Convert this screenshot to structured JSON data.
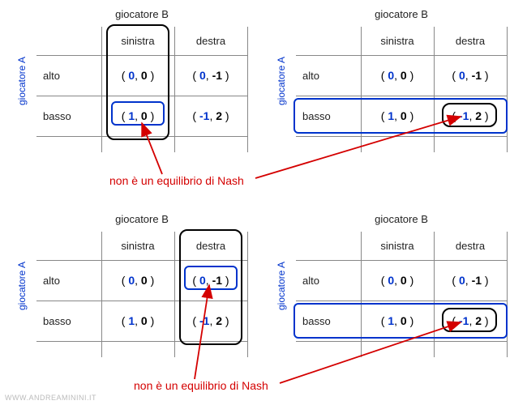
{
  "labels": {
    "playerA": "giocatore A",
    "playerB": "giocatore B",
    "left": "sinistra",
    "right": "destra",
    "top": "alto",
    "bottom": "basso",
    "caption": "non è un equilibrio di Nash",
    "watermark": "WWW.ANDREAMININI.IT"
  },
  "payoffs": {
    "alto_sinistra": {
      "a": "0",
      "b": "0"
    },
    "alto_destra": {
      "a": "0",
      "b": "-1"
    },
    "basso_sinistra": {
      "a": "1",
      "b": "0"
    },
    "basso_destra": {
      "a": "-1",
      "b": "2"
    }
  },
  "chart_data": {
    "type": "table",
    "description": "Four identical 2x2 payoff matrices (game theory normal form). Rows = giocatore A strategies (alto, basso). Columns = giocatore B strategies (sinistra, destra). Cell = (payoff A, payoff B).",
    "row_player": "giocatore A",
    "col_player": "giocatore B",
    "rows": [
      "alto",
      "basso"
    ],
    "cols": [
      "sinistra",
      "destra"
    ],
    "matrix": [
      [
        [
          0,
          0
        ],
        [
          0,
          -1
        ]
      ],
      [
        [
          1,
          0
        ],
        [
          -1,
          2
        ]
      ]
    ],
    "highlights": [
      {
        "panel": 0,
        "black_box": "column sinistra",
        "blue_box": "cell basso/sinistra",
        "arrow_target": "basso/sinistra"
      },
      {
        "panel": 1,
        "black_box": "cell basso/destra",
        "blue_box": "row basso",
        "arrow_target": "basso/destra"
      },
      {
        "panel": 2,
        "black_box": "column destra",
        "blue_box": "cell alto/destra",
        "arrow_target": "alto/destra"
      },
      {
        "panel": 3,
        "black_box": "cell basso/destra",
        "blue_box": "row basso",
        "arrow_target": "basso/destra"
      }
    ],
    "caption": "non è un equilibrio di Nash"
  }
}
